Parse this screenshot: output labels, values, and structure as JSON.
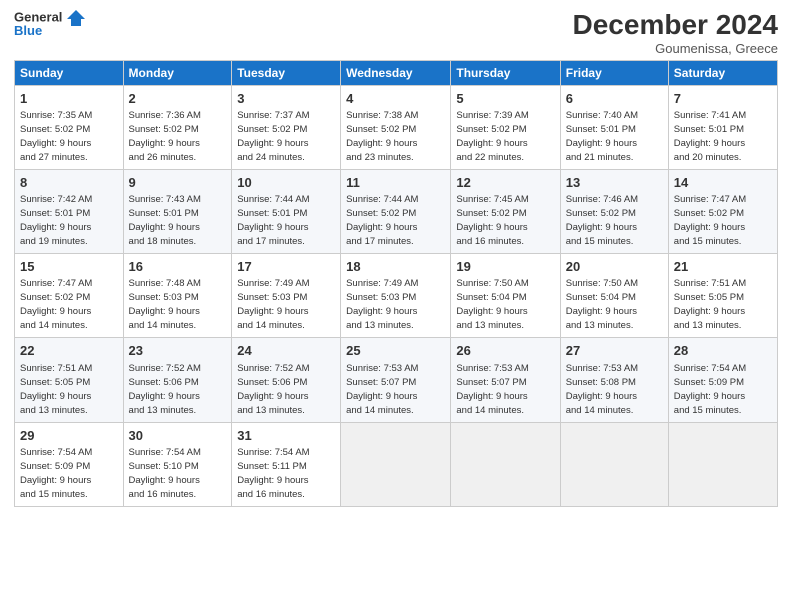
{
  "logo": {
    "line1": "General",
    "line2": "Blue"
  },
  "title": "December 2024",
  "subtitle": "Goumenissa, Greece",
  "days_of_week": [
    "Sunday",
    "Monday",
    "Tuesday",
    "Wednesday",
    "Thursday",
    "Friday",
    "Saturday"
  ],
  "weeks": [
    [
      {
        "day": 1,
        "info": "Sunrise: 7:35 AM\nSunset: 5:02 PM\nDaylight: 9 hours\nand 27 minutes."
      },
      {
        "day": 2,
        "info": "Sunrise: 7:36 AM\nSunset: 5:02 PM\nDaylight: 9 hours\nand 26 minutes."
      },
      {
        "day": 3,
        "info": "Sunrise: 7:37 AM\nSunset: 5:02 PM\nDaylight: 9 hours\nand 24 minutes."
      },
      {
        "day": 4,
        "info": "Sunrise: 7:38 AM\nSunset: 5:02 PM\nDaylight: 9 hours\nand 23 minutes."
      },
      {
        "day": 5,
        "info": "Sunrise: 7:39 AM\nSunset: 5:02 PM\nDaylight: 9 hours\nand 22 minutes."
      },
      {
        "day": 6,
        "info": "Sunrise: 7:40 AM\nSunset: 5:01 PM\nDaylight: 9 hours\nand 21 minutes."
      },
      {
        "day": 7,
        "info": "Sunrise: 7:41 AM\nSunset: 5:01 PM\nDaylight: 9 hours\nand 20 minutes."
      }
    ],
    [
      {
        "day": 8,
        "info": "Sunrise: 7:42 AM\nSunset: 5:01 PM\nDaylight: 9 hours\nand 19 minutes."
      },
      {
        "day": 9,
        "info": "Sunrise: 7:43 AM\nSunset: 5:01 PM\nDaylight: 9 hours\nand 18 minutes."
      },
      {
        "day": 10,
        "info": "Sunrise: 7:44 AM\nSunset: 5:01 PM\nDaylight: 9 hours\nand 17 minutes."
      },
      {
        "day": 11,
        "info": "Sunrise: 7:44 AM\nSunset: 5:02 PM\nDaylight: 9 hours\nand 17 minutes."
      },
      {
        "day": 12,
        "info": "Sunrise: 7:45 AM\nSunset: 5:02 PM\nDaylight: 9 hours\nand 16 minutes."
      },
      {
        "day": 13,
        "info": "Sunrise: 7:46 AM\nSunset: 5:02 PM\nDaylight: 9 hours\nand 15 minutes."
      },
      {
        "day": 14,
        "info": "Sunrise: 7:47 AM\nSunset: 5:02 PM\nDaylight: 9 hours\nand 15 minutes."
      }
    ],
    [
      {
        "day": 15,
        "info": "Sunrise: 7:47 AM\nSunset: 5:02 PM\nDaylight: 9 hours\nand 14 minutes."
      },
      {
        "day": 16,
        "info": "Sunrise: 7:48 AM\nSunset: 5:03 PM\nDaylight: 9 hours\nand 14 minutes."
      },
      {
        "day": 17,
        "info": "Sunrise: 7:49 AM\nSunset: 5:03 PM\nDaylight: 9 hours\nand 14 minutes."
      },
      {
        "day": 18,
        "info": "Sunrise: 7:49 AM\nSunset: 5:03 PM\nDaylight: 9 hours\nand 13 minutes."
      },
      {
        "day": 19,
        "info": "Sunrise: 7:50 AM\nSunset: 5:04 PM\nDaylight: 9 hours\nand 13 minutes."
      },
      {
        "day": 20,
        "info": "Sunrise: 7:50 AM\nSunset: 5:04 PM\nDaylight: 9 hours\nand 13 minutes."
      },
      {
        "day": 21,
        "info": "Sunrise: 7:51 AM\nSunset: 5:05 PM\nDaylight: 9 hours\nand 13 minutes."
      }
    ],
    [
      {
        "day": 22,
        "info": "Sunrise: 7:51 AM\nSunset: 5:05 PM\nDaylight: 9 hours\nand 13 minutes."
      },
      {
        "day": 23,
        "info": "Sunrise: 7:52 AM\nSunset: 5:06 PM\nDaylight: 9 hours\nand 13 minutes."
      },
      {
        "day": 24,
        "info": "Sunrise: 7:52 AM\nSunset: 5:06 PM\nDaylight: 9 hours\nand 13 minutes."
      },
      {
        "day": 25,
        "info": "Sunrise: 7:53 AM\nSunset: 5:07 PM\nDaylight: 9 hours\nand 14 minutes."
      },
      {
        "day": 26,
        "info": "Sunrise: 7:53 AM\nSunset: 5:07 PM\nDaylight: 9 hours\nand 14 minutes."
      },
      {
        "day": 27,
        "info": "Sunrise: 7:53 AM\nSunset: 5:08 PM\nDaylight: 9 hours\nand 14 minutes."
      },
      {
        "day": 28,
        "info": "Sunrise: 7:54 AM\nSunset: 5:09 PM\nDaylight: 9 hours\nand 15 minutes."
      }
    ],
    [
      {
        "day": 29,
        "info": "Sunrise: 7:54 AM\nSunset: 5:09 PM\nDaylight: 9 hours\nand 15 minutes."
      },
      {
        "day": 30,
        "info": "Sunrise: 7:54 AM\nSunset: 5:10 PM\nDaylight: 9 hours\nand 16 minutes."
      },
      {
        "day": 31,
        "info": "Sunrise: 7:54 AM\nSunset: 5:11 PM\nDaylight: 9 hours\nand 16 minutes."
      },
      null,
      null,
      null,
      null
    ]
  ]
}
